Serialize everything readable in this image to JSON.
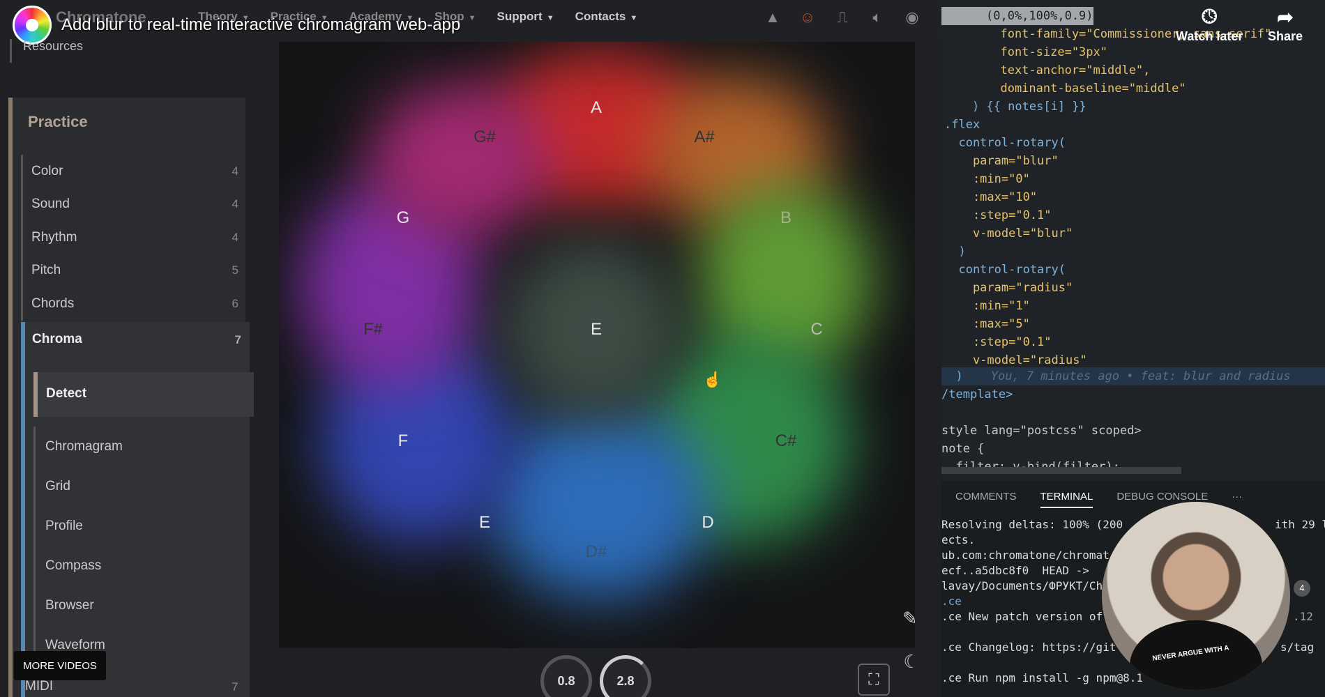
{
  "video": {
    "title": "Add blur to real-time interactive chromagram web-app",
    "watch_later": "Watch later",
    "share": "Share",
    "more_videos": "MORE VIDEOS"
  },
  "nav": {
    "brand": "Chromatone",
    "items": [
      {
        "label": "Theory"
      },
      {
        "label": "Practice"
      },
      {
        "label": "Academy"
      },
      {
        "label": "Shop"
      },
      {
        "label": "Support"
      },
      {
        "label": "Contacts"
      }
    ],
    "icons": [
      "metronome-icon",
      "face-icon",
      "pulse-icon",
      "speaker-icon",
      "record-icon"
    ]
  },
  "sidebar": {
    "resources": "Resources",
    "title": "Practice",
    "items": [
      {
        "label": "Color",
        "count": "4"
      },
      {
        "label": "Sound",
        "count": "4"
      },
      {
        "label": "Rhythm",
        "count": "4"
      },
      {
        "label": "Pitch",
        "count": "5"
      },
      {
        "label": "Chords",
        "count": "6"
      }
    ],
    "chroma": {
      "label": "Chroma",
      "count": "7"
    },
    "active": "Detect",
    "sub_items": [
      {
        "label": "Chromagram"
      },
      {
        "label": "Grid"
      },
      {
        "label": "Profile"
      },
      {
        "label": "Compass"
      },
      {
        "label": "Browser"
      },
      {
        "label": "Waveform"
      }
    ],
    "midi": {
      "label": "MIDI",
      "count": "7"
    }
  },
  "chromagram": {
    "notes": [
      "A",
      "A#",
      "B",
      "C",
      "C#",
      "D",
      "D#",
      "E",
      "F",
      "F#",
      "G",
      "G#"
    ],
    "center": "E",
    "blur": "0.8",
    "radius": "2.8"
  },
  "editor": {
    "lines": [
      "(0,0%,100%,0.9)\"",
      "  font-family=\"Commissioner, sans-serif\"",
      "  font-size=\"3px\"",
      "  text-anchor=\"middle\",",
      "  dominant-baseline=\"middle\"",
      ") {{ notes[i] }}",
      ".flex",
      "  control-rotary(",
      "    param=\"blur\"",
      "    :min=\"0\"",
      "    :max=\"10\"",
      "    :step=\"0.1\"",
      "    v-model=\"blur\"",
      "  )",
      "  control-rotary(",
      "    param=\"radius\"",
      "    :min=\"1\"",
      "    :max=\"5\"",
      "    :step=\"0.1\"",
      "    v-model=\"radius\"",
      "  )",
      "/template>",
      "",
      "style lang=\"postcss\" scoped>",
      "note {",
      "  filter: v-bind(filter);"
    ],
    "blame": "You, 7 minutes ago • feat: blur and radius"
  },
  "panel": {
    "tabs": [
      "COMMENTS",
      "TERMINAL",
      "DEBUG CONSOLE"
    ],
    "active_tab": "TERMINAL",
    "more": "···",
    "lines": [
      "Resolving deltas: 100% (200",
      "ects.",
      "ub.com:chromatone/chromat",
      "ecf..a5dbc8f0  HEAD ->",
      "lavay/Documents/ФРУКТ/Ch",
      ".ce",
      ".ce New patch version of",
      "",
      ".ce Changelog: https://git",
      "",
      ".ce Run npm install -g npm@8.1"
    ],
    "right_fragments": [
      "ith 29 l",
      ".12",
      "s/tag"
    ]
  },
  "webcam": {
    "shirt_text": "NEVER ARGUE WITH A",
    "cart_count": "4"
  }
}
